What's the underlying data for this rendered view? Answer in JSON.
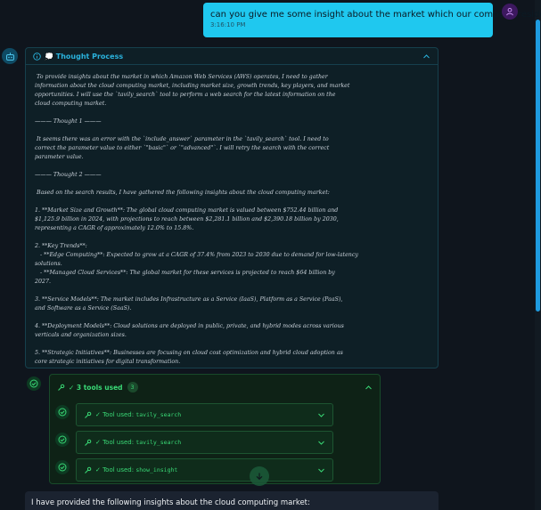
{
  "user_message": {
    "text": "can you give me some insight about the market which our company resides?",
    "time": "3:16:10 PM",
    "avatar_icon": "user-icon"
  },
  "bot": {
    "avatar_icon": "robot-icon"
  },
  "thought_process": {
    "title": "💭 Thought Process",
    "expanded": true,
    "lines": [
      " To provide insights about the market in which Amazon Web Services (AWS) operates, I need to gather",
      "information about the cloud computing market, including market size, growth trends, key players, and market",
      "opportunities. I will use the `tavily_search` tool to perform a web search for the latest information on the",
      "cloud computing market.",
      "",
      "——— Thought 1 ———",
      "",
      " It seems there was an error with the `include_answer` parameter in the `tavily_search` tool. I need to",
      "correct the parameter value to either `\"basic\"` or `\"advanced\"`. I will retry the search with the correct",
      "parameter value.",
      "",
      "——— Thought 2 ———",
      "",
      " Based on the search results, I have gathered the following insights about the cloud computing market:",
      "",
      "1. **Market Size and Growth**: The global cloud computing market is valued between $752.44 billion and",
      "$1,125.9 billion in 2024, with projections to reach between $2,281.1 billion and $2,390.18 billion by 2030,",
      "representing a CAGR of approximately 12.0% to 15.8%.",
      "",
      "2. **Key Trends**:",
      "   - **Edge Computing**: Expected to grow at a CAGR of 37.4% from 2023 to 2030 due to demand for low-latency",
      "solutions.",
      "   - **Managed Cloud Services**: The global market for these services is projected to reach $64 billion by",
      "2027.",
      "",
      "3. **Service Models**: The market includes Infrastructure as a Service (IaaS), Platform as a Service (PaaS),",
      "and Software as a Service (SaaS).",
      "",
      "4. **Deployment Models**: Cloud solutions are deployed in public, private, and hybrid modes across various",
      "verticals and organization sizes.",
      "",
      "5. **Strategic Initiatives**: Businesses are focusing on cloud cost optimization and hybrid cloud adoption as",
      "core strategic initiatives for digital transformation."
    ]
  },
  "tools": {
    "label": "✓ 3 tools used",
    "count": "3",
    "items": [
      {
        "prefix": "✓ Tool used: ",
        "name": "tavily_search"
      },
      {
        "prefix": "✓ Tool used: ",
        "name": "tavily_search"
      },
      {
        "prefix": "✓ Tool used: ",
        "name": "show_insight"
      }
    ]
  },
  "answer": {
    "text": "I have provided the following insights about the cloud computing market:"
  },
  "colors": {
    "background": "#0f151d",
    "user_bubble": "#1fc8ef",
    "thought_accent": "#2ab2dc",
    "tool_accent": "#39d875"
  }
}
